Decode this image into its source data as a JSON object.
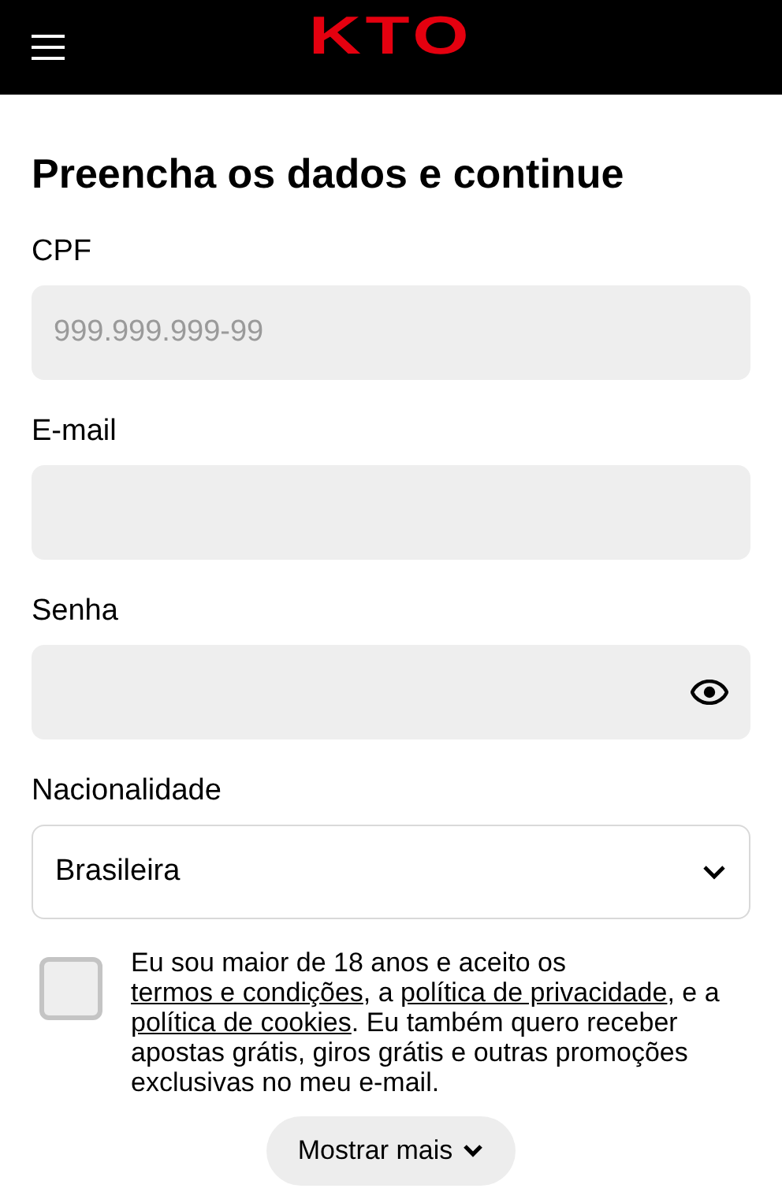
{
  "header": {
    "logo": "KTO"
  },
  "title": "Preencha os dados e continue",
  "fields": [
    {
      "kind": "text",
      "label": "CPF",
      "placeholder": "999.999.999-99"
    },
    {
      "kind": "text",
      "label": "E-mail"
    },
    {
      "kind": "password",
      "label": "Senha"
    },
    {
      "kind": "select",
      "label": "Nacionalidade",
      "value": "Brasileira"
    }
  ],
  "consent": {
    "checked": false,
    "segments": [
      {
        "text": "Eu sou maior de 18 anos e aceito os ",
        "link": false
      },
      {
        "text": "termos e condições",
        "link": true
      },
      {
        "text": ", a ",
        "link": false
      },
      {
        "text": "política de privacidade",
        "link": true
      },
      {
        "text": ", e a ",
        "link": false
      },
      {
        "text": "política de cookies",
        "link": true
      },
      {
        "text": ". Eu também quero receber apostas grátis, giros grátis e outras promoções exclusivas no meu e-mail.",
        "link": false
      }
    ]
  },
  "show_more": {
    "label": "Mostrar mais",
    "expanded": false
  }
}
